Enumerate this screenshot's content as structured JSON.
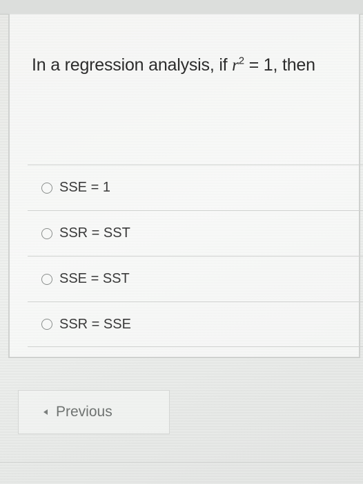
{
  "question": {
    "prefix": "In a regression analysis, if ",
    "variable": "r",
    "exponent": "2",
    "suffix": " = 1, then"
  },
  "answers": [
    {
      "label": "SSE = 1"
    },
    {
      "label": "SSR = SST"
    },
    {
      "label": "SSE = SST"
    },
    {
      "label": "SSR = SSE"
    }
  ],
  "navigation": {
    "previous_label": "Previous"
  }
}
